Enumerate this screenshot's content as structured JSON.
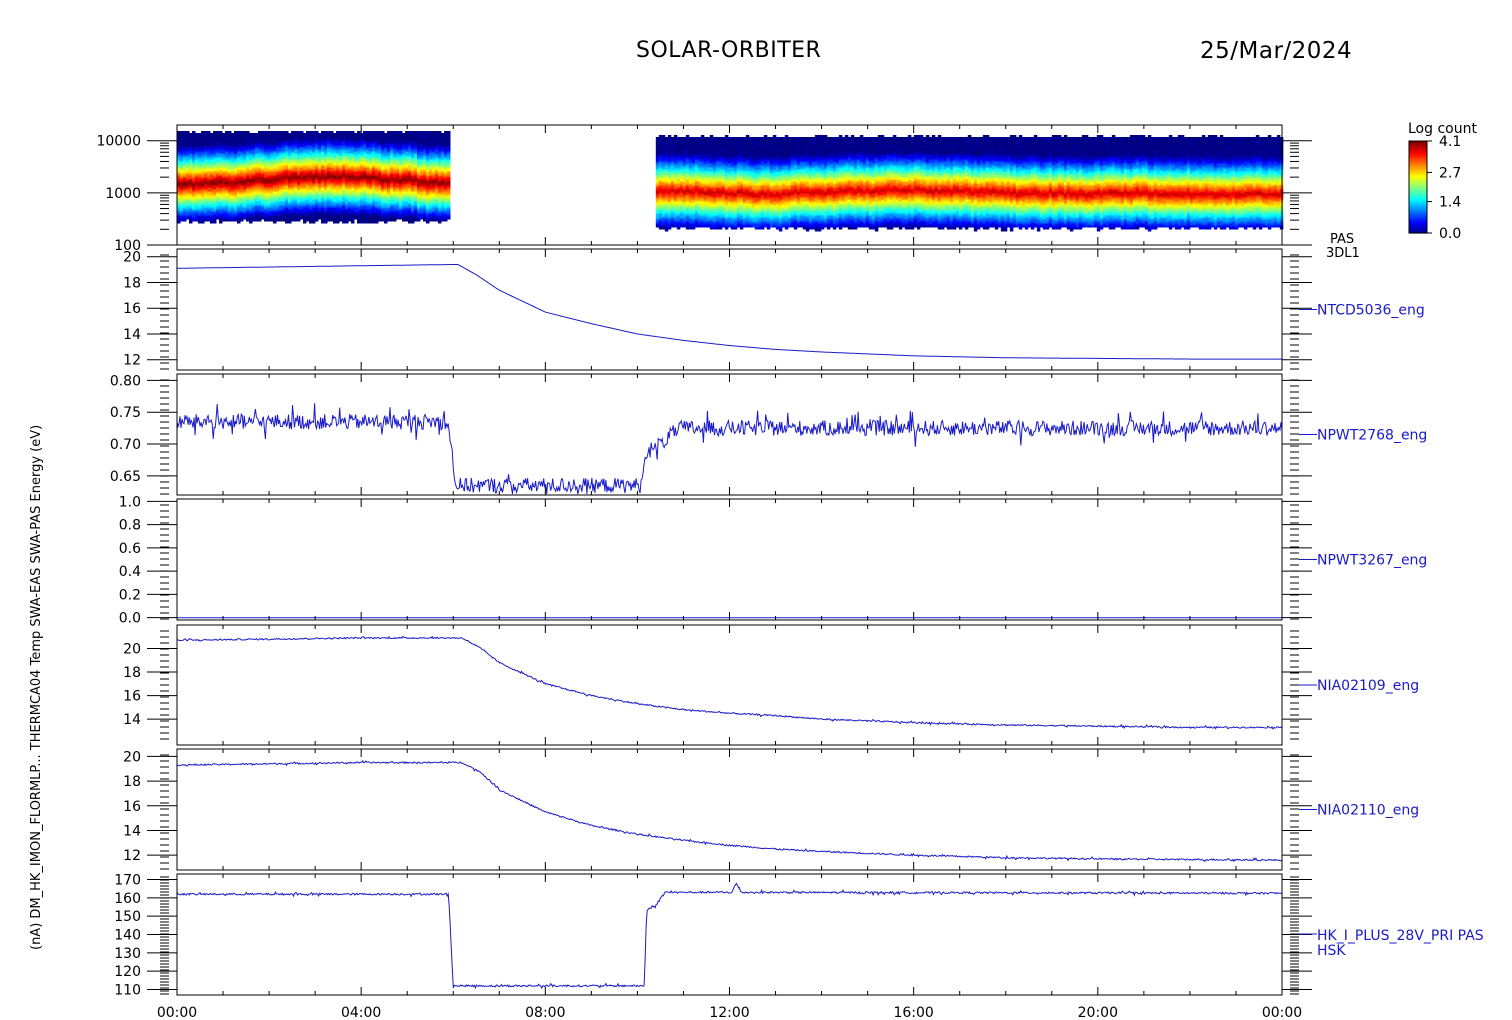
{
  "header": {
    "mission": "SOLAR-ORBITER",
    "date": "25/Mar/2024"
  },
  "colorbar": {
    "title": "Log count",
    "ticks": [
      "4.1",
      "2.7",
      "1.4",
      "0.0"
    ],
    "range": [
      0.0,
      4.1
    ]
  },
  "y_axis_stacked_label": "(nA) DM_HK_IMON_FLORMLP... THERMCA04 Temp SWA-EAS SWA-PAS Energy (eV)",
  "colors": {
    "trace": "#1a1ac8",
    "frame": "#000000",
    "right_label": "#1a1ac8"
  },
  "chart_data": [
    {
      "type": "heatmap",
      "name_lines": [
        "PAS",
        "3DL1"
      ],
      "ylabel": "Energy (eV)",
      "yscale": "log",
      "ylim": [
        100,
        20000
      ],
      "yticks": [
        "10000",
        "1000",
        "100"
      ],
      "ytick_values": [
        10000,
        1000,
        100
      ],
      "segments": [
        {
          "start_h": 0.0,
          "end_h": 5.9,
          "peak_eV": [
            1500,
            1600,
            1800,
            2000,
            2100,
            2000,
            1800,
            1600
          ]
        },
        {
          "start_h": 10.4,
          "end_h": 24.0,
          "peak_eV": [
            1100,
            1000,
            950,
            1050,
            1100,
            1150,
            1100,
            1050,
            1000,
            980,
            1000,
            990,
            950,
            970
          ]
        }
      ]
    },
    {
      "type": "line",
      "name": "NTCD5036_eng",
      "ylim": [
        11.2,
        20.6
      ],
      "yticks": [
        "20",
        "18",
        "16",
        "14",
        "12"
      ],
      "ytick_values": [
        20,
        18,
        16,
        14,
        12
      ],
      "x": [
        0,
        2,
        4,
        6.1,
        6.5,
        7,
        8,
        9,
        10,
        11,
        12,
        13,
        14,
        16,
        18,
        20,
        22,
        24
      ],
      "y": [
        19.1,
        19.2,
        19.3,
        19.4,
        18.6,
        17.4,
        15.7,
        14.8,
        14.0,
        13.5,
        13.1,
        12.8,
        12.6,
        12.3,
        12.15,
        12.1,
        12.05,
        12.05
      ]
    },
    {
      "type": "line",
      "name": "NPWT2768_eng",
      "noise": 0.012,
      "ylim": [
        0.62,
        0.81
      ],
      "yticks": [
        "0.80",
        "0.75",
        "0.70",
        "0.65"
      ],
      "ytick_values": [
        0.8,
        0.75,
        0.7,
        0.65
      ],
      "x": [
        0,
        5.9,
        6.05,
        10.1,
        10.15,
        10.5,
        10.9,
        24
      ],
      "y": [
        0.735,
        0.735,
        0.635,
        0.635,
        0.685,
        0.7,
        0.725,
        0.725
      ]
    },
    {
      "type": "line",
      "name": "NPWT3267_eng",
      "ylim": [
        -0.02,
        1.02
      ],
      "yticks": [
        "1.0",
        "0.8",
        "0.6",
        "0.4",
        "0.2",
        "0.0"
      ],
      "ytick_values": [
        1.0,
        0.8,
        0.6,
        0.4,
        0.2,
        0.0
      ],
      "x": [
        0,
        24
      ],
      "y": [
        0.0,
        0.0
      ]
    },
    {
      "type": "line",
      "name": "NIA02109_eng",
      "noise": 0.06,
      "ylim": [
        11.8,
        22.0
      ],
      "yticks": [
        "20",
        "18",
        "16",
        "14"
      ],
      "ytick_values": [
        20,
        18,
        16,
        14
      ],
      "x": [
        0,
        2,
        4,
        6.2,
        6.6,
        7,
        8,
        9,
        10,
        11,
        12,
        13,
        14,
        16,
        18,
        20,
        22,
        24
      ],
      "y": [
        20.7,
        20.8,
        20.9,
        20.9,
        20.0,
        18.8,
        17.0,
        16.0,
        15.3,
        14.8,
        14.5,
        14.3,
        14.0,
        13.7,
        13.5,
        13.4,
        13.3,
        13.3
      ]
    },
    {
      "type": "line",
      "name": "NIA02110_eng",
      "noise": 0.06,
      "ylim": [
        10.8,
        20.6
      ],
      "yticks": [
        "20",
        "18",
        "16",
        "14",
        "12"
      ],
      "ytick_values": [
        20,
        18,
        16,
        14,
        12
      ],
      "x": [
        0,
        2,
        4,
        6.2,
        6.6,
        7,
        8,
        9,
        10,
        11,
        12,
        13,
        14,
        16,
        18,
        20,
        22,
        24
      ],
      "y": [
        19.3,
        19.4,
        19.5,
        19.5,
        18.7,
        17.3,
        15.5,
        14.4,
        13.7,
        13.2,
        12.8,
        12.5,
        12.3,
        12.0,
        11.8,
        11.7,
        11.65,
        11.6
      ]
    },
    {
      "type": "line",
      "name": "HK_I_PLUS_28V_PRI PAS",
      "name_line2": "HSK",
      "noise": 0.5,
      "ylim": [
        107,
        173
      ],
      "yticks": [
        "170",
        "160",
        "150",
        "140",
        "130",
        "120",
        "110"
      ],
      "ytick_values": [
        170,
        160,
        150,
        140,
        130,
        120,
        110
      ],
      "x": [
        0,
        5.9,
        6.0,
        10.15,
        10.2,
        10.4,
        10.6,
        12.05,
        12.15,
        12.25,
        24
      ],
      "y": [
        162,
        162,
        112,
        112,
        153,
        156,
        163,
        163,
        168,
        163,
        162.5
      ]
    }
  ],
  "x_axis": {
    "range_h": [
      0,
      24
    ],
    "tick_labels": [
      "00:00",
      "04:00",
      "08:00",
      "12:00",
      "16:00",
      "20:00",
      "00:00"
    ],
    "tick_values_h": [
      0,
      4,
      8,
      12,
      16,
      20,
      24
    ]
  }
}
